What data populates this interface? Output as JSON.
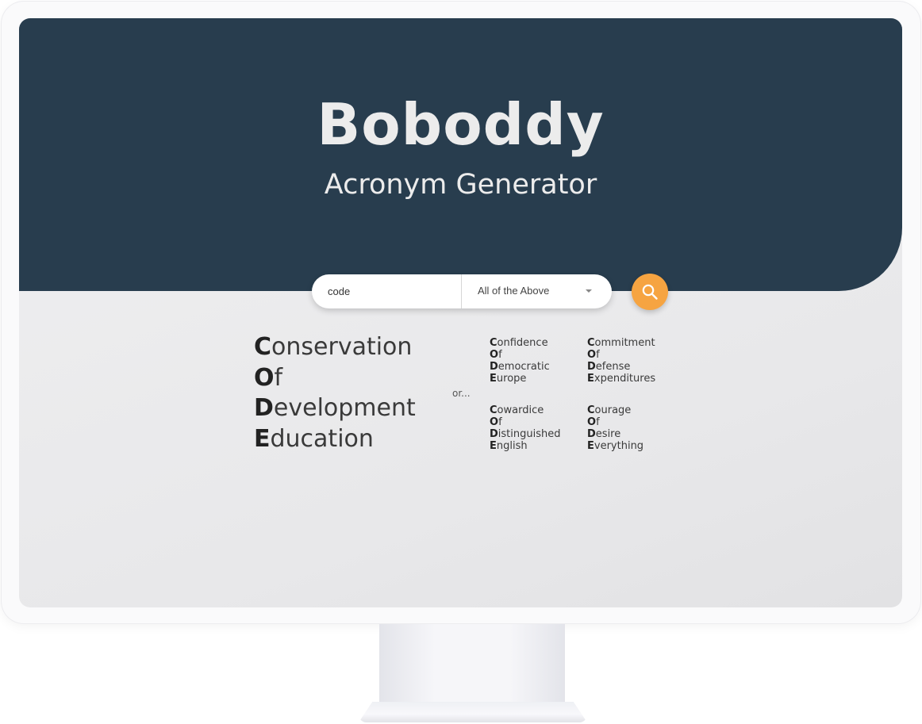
{
  "brand": {
    "title": "Boboddy",
    "subtitle": "Acronym Generator"
  },
  "search": {
    "value": "code",
    "placeholder": "",
    "filter_selected": "All of the Above",
    "button_icon": "search-icon"
  },
  "results": {
    "main": {
      "lines": [
        {
          "initial": "C",
          "rest": "onservation"
        },
        {
          "initial": "O",
          "rest": "f"
        },
        {
          "initial": "D",
          "rest": "evelopment"
        },
        {
          "initial": "E",
          "rest": "ducation"
        }
      ]
    },
    "or_label": "or...",
    "alternatives": [
      {
        "lines": [
          {
            "initial": "C",
            "rest": "onfidence"
          },
          {
            "initial": "O",
            "rest": "f"
          },
          {
            "initial": "D",
            "rest": "emocratic"
          },
          {
            "initial": "E",
            "rest": "urope"
          }
        ]
      },
      {
        "lines": [
          {
            "initial": "C",
            "rest": "ommitment"
          },
          {
            "initial": "O",
            "rest": "f"
          },
          {
            "initial": "D",
            "rest": "efense"
          },
          {
            "initial": "E",
            "rest": "xpenditures"
          }
        ]
      },
      {
        "lines": [
          {
            "initial": "C",
            "rest": "owardice"
          },
          {
            "initial": "O",
            "rest": "f"
          },
          {
            "initial": "D",
            "rest": "istinguished"
          },
          {
            "initial": "E",
            "rest": "nglish"
          }
        ]
      },
      {
        "lines": [
          {
            "initial": "C",
            "rest": "ourage"
          },
          {
            "initial": "O",
            "rest": "f"
          },
          {
            "initial": "D",
            "rest": "esire"
          },
          {
            "initial": "E",
            "rest": "verything"
          }
        ]
      }
    ]
  },
  "colors": {
    "hero_background": "#283d4e",
    "accent": "#f6a441",
    "page_background": "#ececed"
  }
}
